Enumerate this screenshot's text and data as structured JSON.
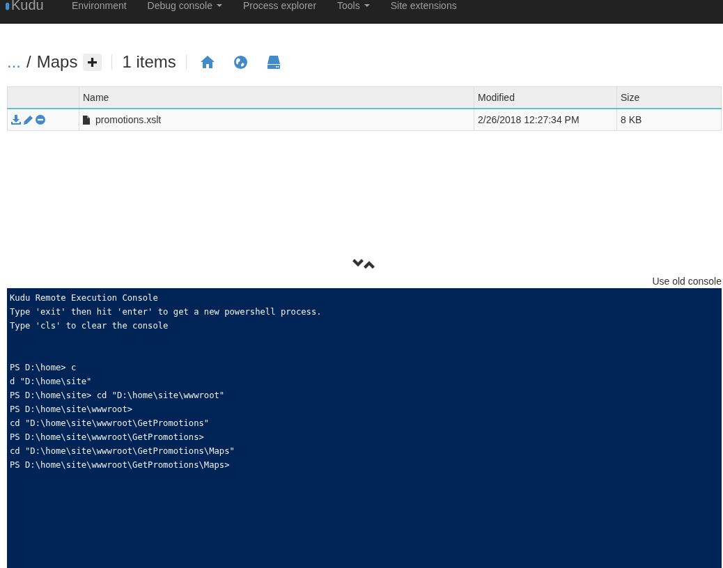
{
  "navbar": {
    "brand": "Kudu",
    "items": [
      {
        "label": "Environment",
        "dropdown": false
      },
      {
        "label": "Debug console",
        "dropdown": true
      },
      {
        "label": "Process explorer",
        "dropdown": false
      },
      {
        "label": "Tools",
        "dropdown": true
      },
      {
        "label": "Site extensions",
        "dropdown": false
      }
    ]
  },
  "breadcrumb": {
    "parent": "...",
    "separator": "/",
    "current": "Maps",
    "count": "1 items"
  },
  "table": {
    "columns": [
      "Name",
      "Modified",
      "Size"
    ],
    "rows": [
      {
        "name": "promotions.xslt",
        "modified": "2/26/2018 12:27:34 PM",
        "size": "8 KB"
      }
    ]
  },
  "console": {
    "switch_link": "Use old console",
    "header": [
      "Kudu Remote Execution Console",
      "Type 'exit' then hit 'enter' to get a new powershell process.",
      "Type 'cls' to clear the console"
    ],
    "lines": [
      "PS D:\\home> c",
      "d \"D:\\home\\site\"",
      "PS D:\\home\\site> cd \"D:\\home\\site\\wwwroot\"",
      "PS D:\\home\\site\\wwwroot>",
      "cd \"D:\\home\\site\\wwwroot\\GetPromotions\"",
      "PS D:\\home\\site\\wwwroot\\GetPromotions>",
      "cd \"D:\\home\\site\\wwwroot\\GetPromotions\\Maps\"",
      "PS D:\\home\\site\\wwwroot\\GetPromotions\\Maps>"
    ]
  }
}
